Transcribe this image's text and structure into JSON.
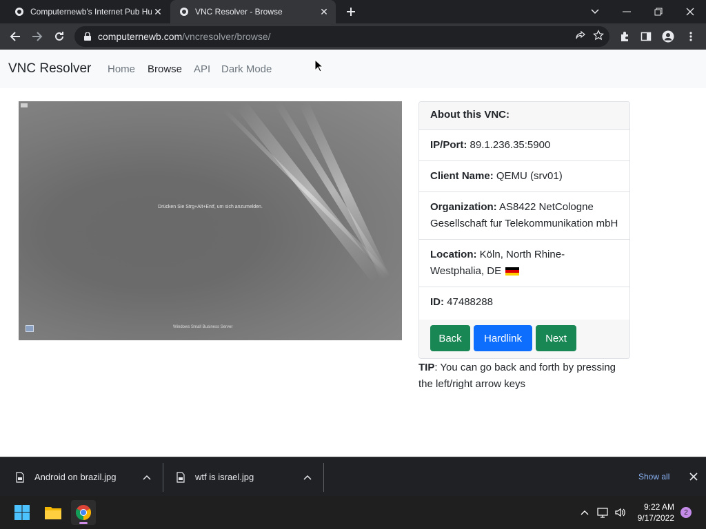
{
  "browser": {
    "tabs": [
      {
        "title": "Computernewb's Internet Pub Hu",
        "active": false
      },
      {
        "title": "VNC Resolver - Browse",
        "active": true
      }
    ],
    "url_host": "computernewb.com",
    "url_path": "/vncresolver/browse/"
  },
  "navbar": {
    "brand": "VNC Resolver",
    "links": [
      "Home",
      "Browse",
      "API",
      "Dark Mode"
    ],
    "active_link": "Browse"
  },
  "screenshot": {
    "login_prompt": "Drücken Sie Strg+Alt+Entf, um sich anzumelden.",
    "os_label": "Windows Small Business Server"
  },
  "card": {
    "header": "About this VNC:",
    "ip_label": "IP/Port:",
    "ip_value": "89.1.236.35:5900",
    "client_label": "Client Name:",
    "client_value": "QEMU (srv01)",
    "org_label": "Organization:",
    "org_value": "AS8422 NetCologne Gesellschaft fur Telekommunikation mbH",
    "location_label": "Location:",
    "location_value": "Köln, North Rhine-Westphalia, DE",
    "id_label": "ID:",
    "id_value": "47488288",
    "buttons": {
      "back": "Back",
      "hardlink": "Hardlink",
      "next": "Next"
    },
    "colors": {
      "green": "#198754",
      "blue": "#0d6efd"
    }
  },
  "tip": {
    "label": "TIP",
    "text": ": You can go back and forth by pressing the left/right arrow keys"
  },
  "downloads": {
    "items": [
      "Android on brazil.jpg",
      "wtf is israel.jpg"
    ],
    "show_all": "Show all"
  },
  "taskbar": {
    "time": "9:22 AM",
    "date": "9/17/2022",
    "notifications": "2"
  }
}
